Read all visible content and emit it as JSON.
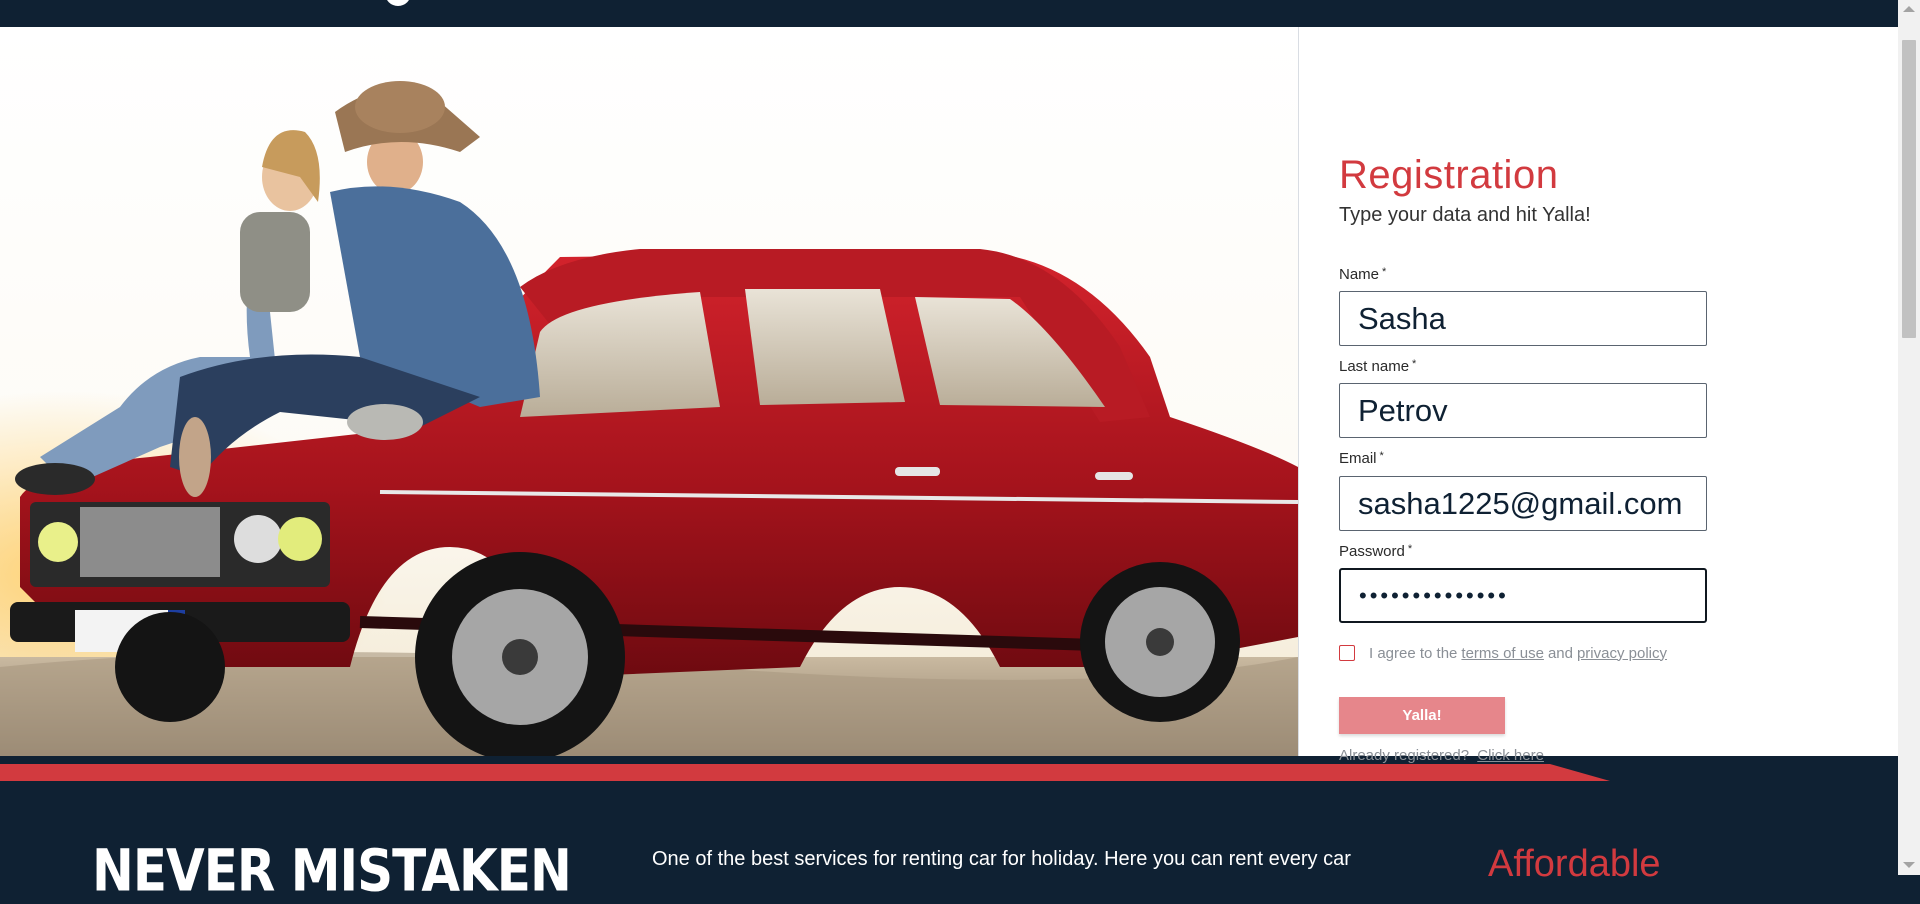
{
  "form": {
    "title": "Registration",
    "subtitle": "Type your data and hit Yalla!",
    "name_label": "Name",
    "name_value": "Sasha",
    "lastname_label": "Last name",
    "lastname_value": "Petrov",
    "email_label": "Email",
    "email_value": "sasha1225@gmail.com",
    "password_label": "Password",
    "password_value": "••••••••••••••",
    "required_mark": "*",
    "agree_prefix": "I agree to the",
    "terms_link": "terms of use",
    "agree_and": "and",
    "privacy_link": "privacy policy",
    "submit_label": "Yalla!",
    "already_text": "Already registered?",
    "click_here_link": "Click here"
  },
  "footer": {
    "heading": "NEVER MISTAKEN",
    "about": "One of the best services for renting car for holiday. Here you can rent every car",
    "affordable": "Affordable"
  },
  "colors": {
    "navy": "#0f2133",
    "accent_red": "#d23a3f",
    "button_pink": "#e6868b"
  },
  "icons": {
    "scroll_up": "triangle-up-icon",
    "scroll_down": "triangle-down-icon"
  }
}
